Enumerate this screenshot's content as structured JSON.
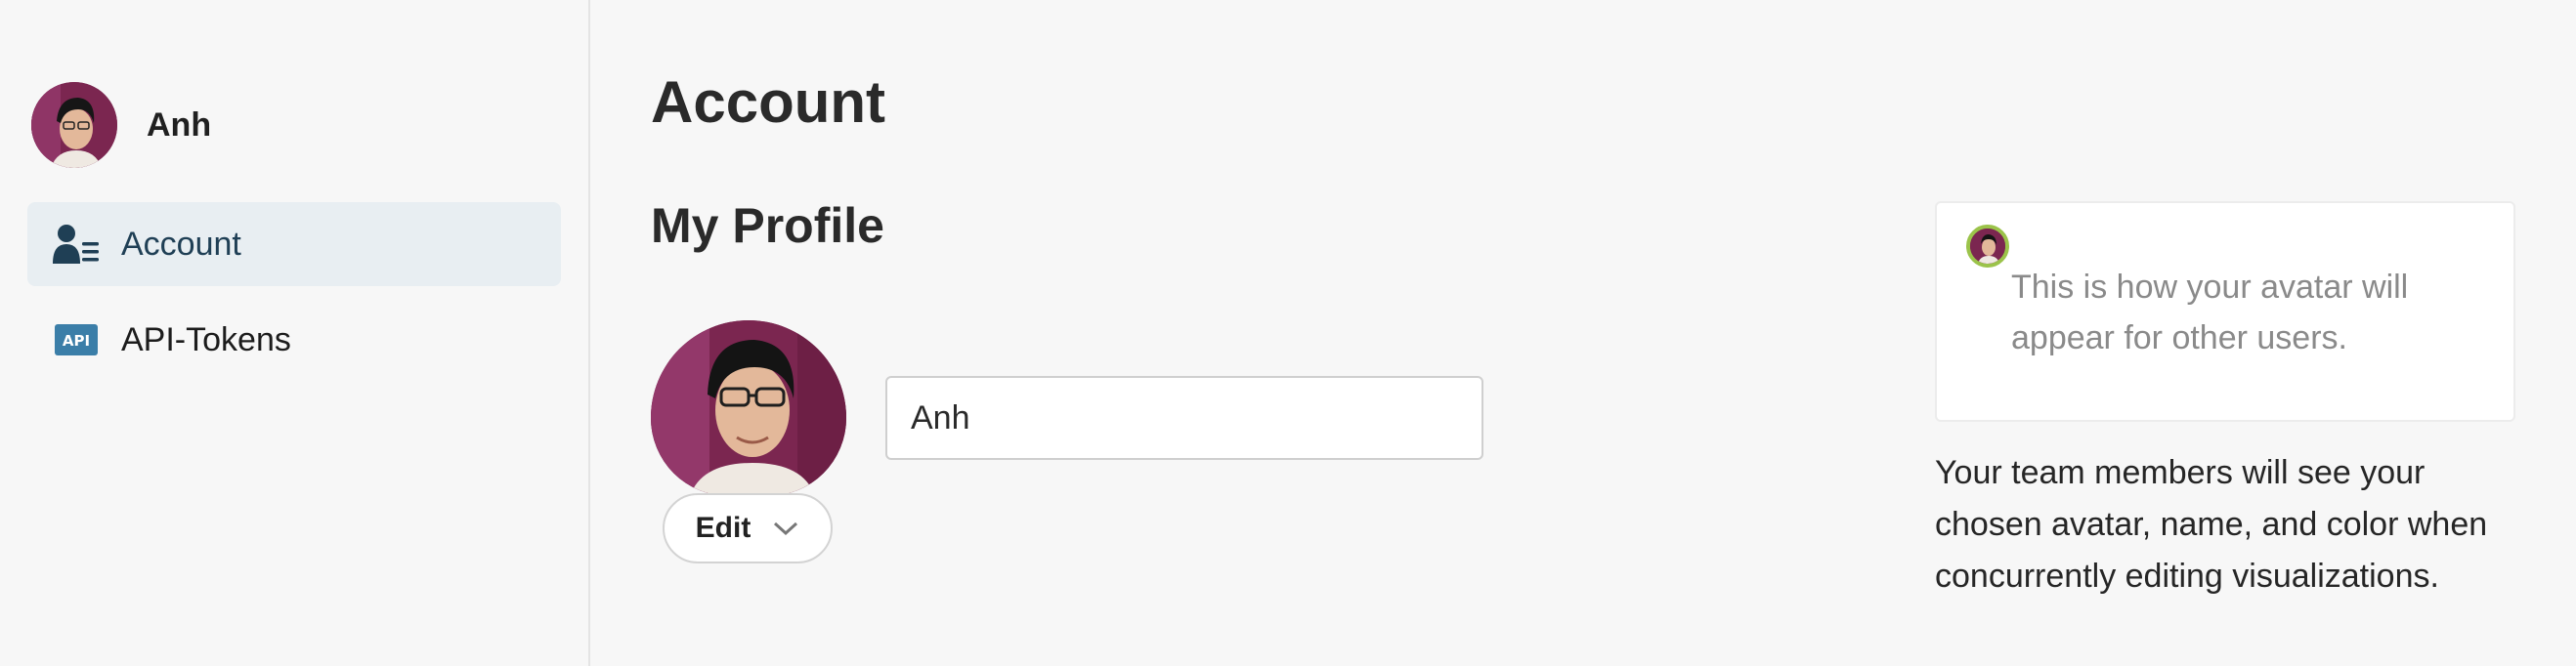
{
  "user": {
    "name": "Anh"
  },
  "sidebar": {
    "items": [
      {
        "label": "Account",
        "icon": "account-list-icon",
        "active": true
      },
      {
        "label": "API-Tokens",
        "icon": "api-icon",
        "icon_text": "API",
        "active": false
      }
    ]
  },
  "main": {
    "title": "Account",
    "section_title": "My Profile",
    "name_value": "Anh",
    "edit_label": "Edit",
    "preview_text": "This is how your avatar will appear for other users.",
    "info_text": "Your team members will see your chosen avatar, name, and color when concurrently editing visualizations."
  },
  "colors": {
    "background": "#f7f7f7",
    "active_nav": "#e8eef2",
    "active_text": "#1f3f55",
    "api_badge": "#3b7ea8",
    "presence_ring": "#9bc34a"
  }
}
